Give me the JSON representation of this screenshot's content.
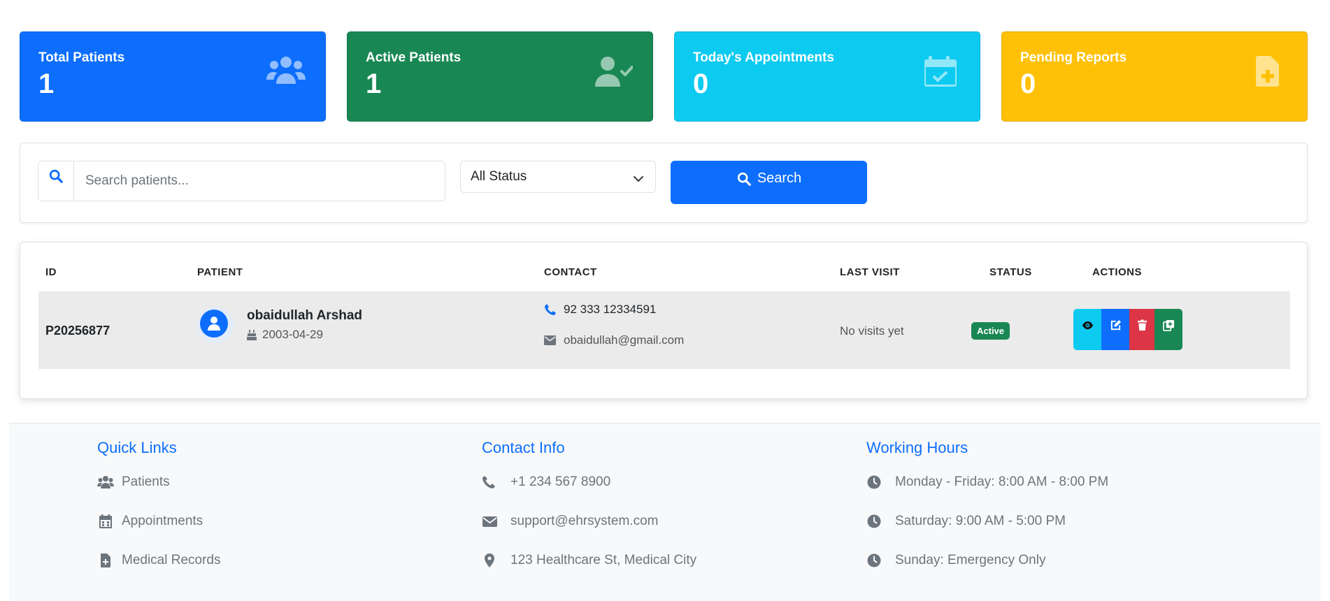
{
  "stats": [
    {
      "label": "Total Patients",
      "value": "1",
      "icon": "users-icon",
      "color": "#0d6efd"
    },
    {
      "label": "Active Patients",
      "value": "1",
      "icon": "user-check-icon",
      "color": "#198754"
    },
    {
      "label": "Today's Appointments",
      "value": "0",
      "icon": "calendar-check-icon",
      "color": "#0dcaf0"
    },
    {
      "label": "Pending Reports",
      "value": "0",
      "icon": "file-medical-icon",
      "color": "#ffc107"
    }
  ],
  "search": {
    "placeholder": "Search patients...",
    "status_selected": "All Status",
    "button_label": "Search"
  },
  "table": {
    "headers": [
      "ID",
      "PATIENT",
      "CONTACT",
      "LAST VISIT",
      "STATUS",
      "ACTIONS"
    ],
    "rows": [
      {
        "id": "P20256877",
        "name": "obaidullah Arshad",
        "dob": "2003-04-29",
        "phone": "92 333 12334591",
        "email": "obaidullah@gmail.com",
        "last_visit": "No visits yet",
        "status": "Active"
      }
    ]
  },
  "footer": {
    "quick_links": {
      "title": "Quick Links",
      "items": [
        "Patients",
        "Appointments",
        "Medical Records"
      ]
    },
    "contact": {
      "title": "Contact Info",
      "items": [
        "+1 234 567 8900",
        "support@ehrsystem.com",
        "123 Healthcare St, Medical City"
      ]
    },
    "hours": {
      "title": "Working Hours",
      "items": [
        "Monday - Friday: 8:00 AM - 8:00 PM",
        "Saturday: 9:00 AM - 5:00 PM",
        "Sunday: Emergency Only"
      ]
    }
  }
}
